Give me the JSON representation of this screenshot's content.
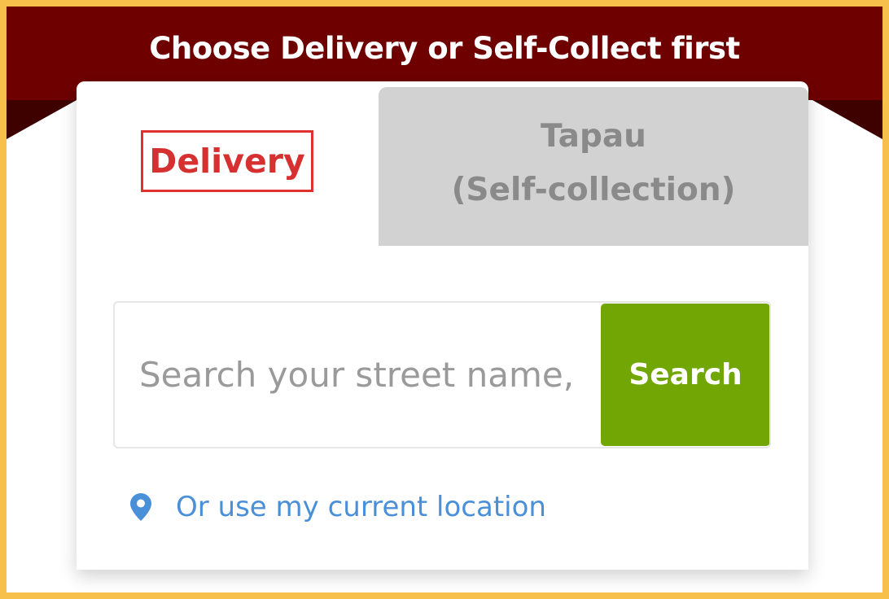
{
  "banner": {
    "title": "Choose Delivery or Self-Collect first",
    "background": "#6e0000"
  },
  "tabs": [
    {
      "label": "Delivery",
      "active": true,
      "color": "#d63030"
    },
    {
      "label_line1": "Tapau",
      "label_line2": "(Self-collection)",
      "active": false,
      "background": "#d2d2d2"
    }
  ],
  "search": {
    "placeholder": "Search your street name,",
    "value": "",
    "button_label": "Search",
    "button_color": "#72a604"
  },
  "location": {
    "icon": "map-pin-icon",
    "link_text": "Or use my current location",
    "color": "#4a90d9"
  },
  "frame": {
    "border_color": "#f6c04a"
  }
}
